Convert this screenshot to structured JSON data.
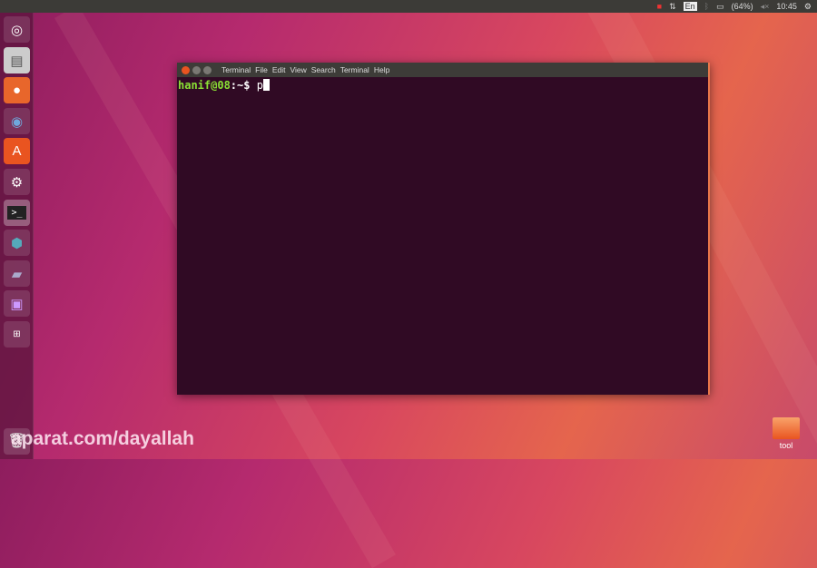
{
  "topbar": {
    "language": "En",
    "battery": "(64%)",
    "clock": "10:45"
  },
  "launcher": {
    "items": [
      "Ubuntu Dash",
      "Files",
      "Firefox",
      "Chromium",
      "Ubuntu Software",
      "System Settings",
      "Terminal",
      "VirtualBox",
      "Disk",
      "Media",
      "Workspaces"
    ]
  },
  "terminal": {
    "title": "Terminal",
    "menu": [
      "File",
      "Edit",
      "View",
      "Search",
      "Terminal",
      "Help"
    ],
    "user_host": "hanif@08",
    "path": ":~",
    "prompt": "$ ",
    "input": "p"
  },
  "desktop": {
    "folder_label": "tool"
  },
  "watermark": "aparat.com/dayallah"
}
